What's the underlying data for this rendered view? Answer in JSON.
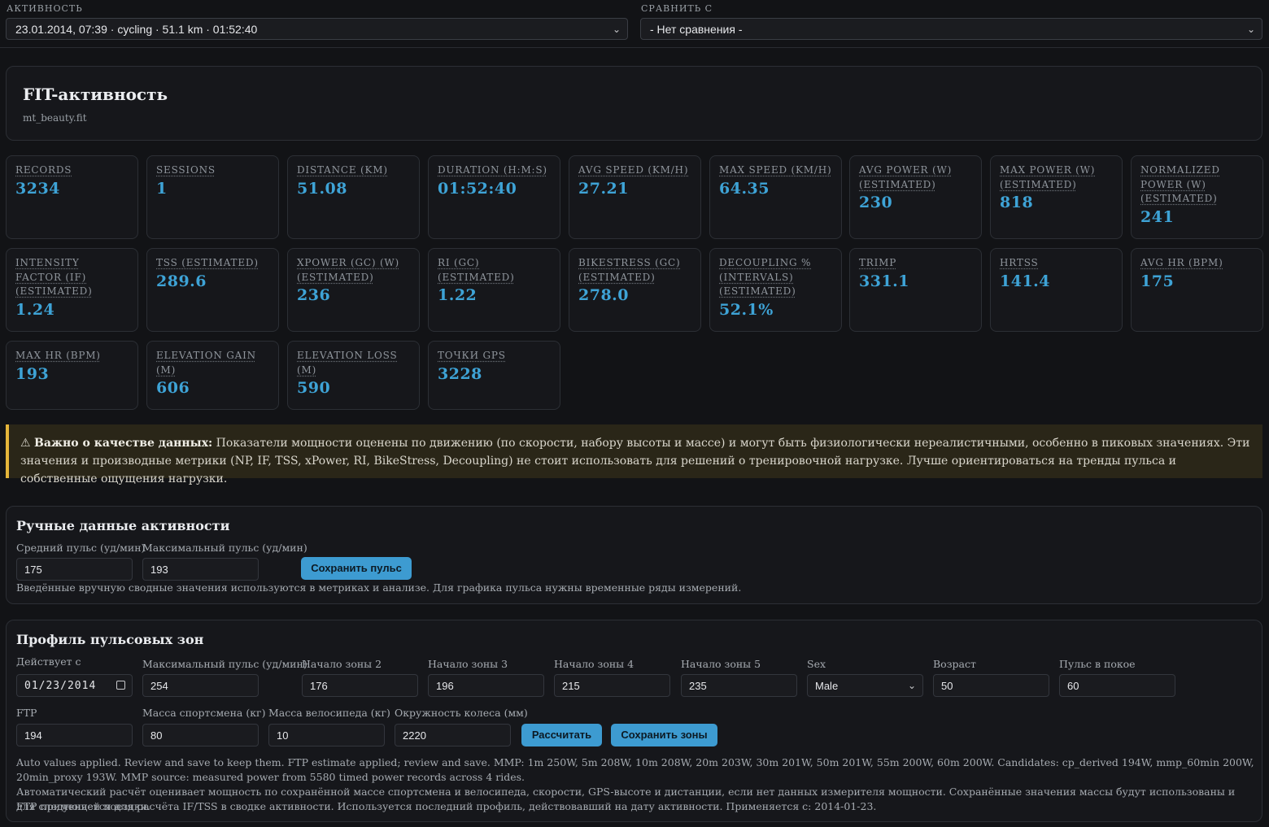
{
  "top": {
    "activity_label": "АКТИВНОСТЬ",
    "activity_value": "23.01.2014, 07:39 · cycling · 51.1 km · 01:52:40",
    "compare_label": "СРАВНИТЬ С",
    "compare_value": "- Нет сравнения -"
  },
  "header": {
    "title": "FIT-активность",
    "file": "mt_beauty.fit"
  },
  "metrics": [
    {
      "label": "RECORDS",
      "value": "3234"
    },
    {
      "label": "SESSIONS",
      "value": "1"
    },
    {
      "label": "DISTANCE (KM)",
      "value": "51.08"
    },
    {
      "label": "DURATION (H:M:S)",
      "value": "01:52:40"
    },
    {
      "label": "AVG SPEED (KM/H)",
      "value": "27.21"
    },
    {
      "label": "MAX SPEED (KM/H)",
      "value": "64.35"
    },
    {
      "label": "AVG POWER (W) (ESTIMATED)",
      "value": "230"
    },
    {
      "label": "MAX POWER (W) (ESTIMATED)",
      "value": "818"
    },
    {
      "label": "NORMALIZED POWER (W) (ESTIMATED)",
      "value": "241"
    },
    {
      "label": "INTENSITY FACTOR (IF) (ESTIMATED)",
      "value": "1.24"
    },
    {
      "label": "TSS (ESTIMATED)",
      "value": "289.6"
    },
    {
      "label": "XPOWER (GC) (W) (ESTIMATED)",
      "value": "236"
    },
    {
      "label": "RI (GC) (ESTIMATED)",
      "value": "1.22"
    },
    {
      "label": "BIKESTRESS (GC) (ESTIMATED)",
      "value": "278.0"
    },
    {
      "label": "DECOUPLING % (INTERVALS) (ESTIMATED)",
      "value": "52.1%"
    },
    {
      "label": "TRIMP",
      "value": "331.1"
    },
    {
      "label": "HRTSS",
      "value": "141.4"
    },
    {
      "label": "AVG HR (BPM)",
      "value": "175"
    },
    {
      "label": "MAX HR (BPM)",
      "value": "193"
    },
    {
      "label": "ELEVATION GAIN (M)",
      "value": "606"
    },
    {
      "label": "ELEVATION LOSS (M)",
      "value": "590"
    },
    {
      "label": "ТОЧКИ GPS",
      "value": "3228"
    }
  ],
  "warning": {
    "icon": "⚠",
    "strong": "Важно о качестве данных:",
    "text": "Показатели мощности оценены по движению (по скорости, набору высоты и массе) и могут быть физиологически нереалистичными, особенно в пиковых значениях. Эти значения и производные метрики (NP, IF, TSS, xPower, RI, BikeStress, Decoupling) не стоит использовать для решений о тренировочной нагрузке. Лучше ориентироваться на тренды пульса и собственные ощущения нагрузки."
  },
  "manual": {
    "title": "Ручные данные активности",
    "avg_hr_label": "Средний пульс (уд/мин)",
    "avg_hr_value": "175",
    "max_hr_label": "Максимальный пульс (уд/мин)",
    "max_hr_value": "193",
    "save_button": "Сохранить пульс",
    "note": "Введённые вручную сводные значения используются в метриках и анализе. Для графика пульса нужны временные ряды измерений."
  },
  "zones": {
    "title": "Профиль пульсовых зон",
    "effective_label": "Действует с",
    "effective_value": "01/23/2014",
    "max_hr_label": "Максимальный пульс (уд/мин)",
    "max_hr_value": "254",
    "zone2_label": "Начало зоны 2",
    "zone2_value": "176",
    "zone3_label": "Начало зоны 3",
    "zone3_value": "196",
    "zone4_label": "Начало зоны 4",
    "zone4_value": "215",
    "zone5_label": "Начало зоны 5",
    "zone5_value": "235",
    "sex_label": "Sex",
    "sex_value": "Male",
    "age_label": "Возраст",
    "age_value": "50",
    "rest_label": "Пульс в покое",
    "rest_value": "60",
    "ftp_label": "FTP",
    "ftp_value": "194",
    "athlete_mass_label": "Масса спортсмена (кг)",
    "athlete_mass_value": "80",
    "bike_mass_label": "Масса велосипеда (кг)",
    "bike_mass_value": "10",
    "wheel_label": "Окружность колеса (мм)",
    "wheel_value": "2220",
    "calc_button": "Рассчитать",
    "save_button": "Сохранить зоны",
    "note1": "Auto values applied. Review and save to keep them. FTP estimate applied; review and save. MMP: 1m 250W, 5m 208W, 10m 208W, 20m 203W, 30m 201W, 50m 201W, 55m 200W, 60m 200W. Candidates: cp_derived 194W, mmp_60min 200W, 20min_proxy 193W. MMP source: measured power from 5580 timed power records across 4 rides.",
    "note2": "Автоматический расчёт оценивает мощность по сохранённой массе спортсмена и велосипеда, скорости, GPS-высоте и дистанции, если нет данных измерителя мощности. Сохранённые значения массы будут использованы и для следующей поездки.",
    "note3": "FTP применяется для расчёта IF/TSS в сводке активности. Используется последний профиль, действовавший на дату активности. Применяется с: 2014-01-23."
  }
}
